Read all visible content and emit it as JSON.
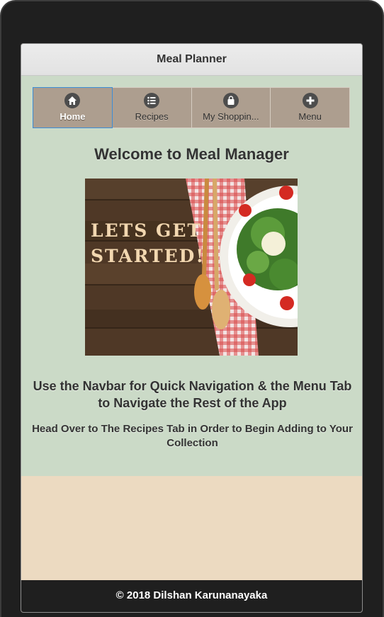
{
  "header": {
    "title": "Meal Planner"
  },
  "navbar": {
    "items": [
      {
        "label": "Home",
        "icon": "home-icon",
        "active": true
      },
      {
        "label": "Recipes",
        "icon": "list-icon",
        "active": false
      },
      {
        "label": "My Shoppin...",
        "icon": "shopping-bag-icon",
        "active": false
      },
      {
        "label": "Menu",
        "icon": "plus-icon",
        "active": false
      }
    ]
  },
  "main": {
    "heading": "Welcome to Meal Manager",
    "hero_image": {
      "text_line1": "LETS GET",
      "text_line2": "STARTED!"
    },
    "instruction": "Use the Navbar for Quick Navigation & the Menu Tab to Navigate the Rest of the App",
    "hint": "Head Over to The Recipes Tab in Order to Begin Adding to Your Collection"
  },
  "footer": {
    "text": "© 2018 Dilshan Karunanayaka"
  },
  "colors": {
    "content_bg": "#cbdac7",
    "page_bg": "#ecdac1",
    "nav_bg": "#ad9e8f",
    "footer_bg": "#1f1f1f",
    "active_border": "#3b8ed8"
  }
}
